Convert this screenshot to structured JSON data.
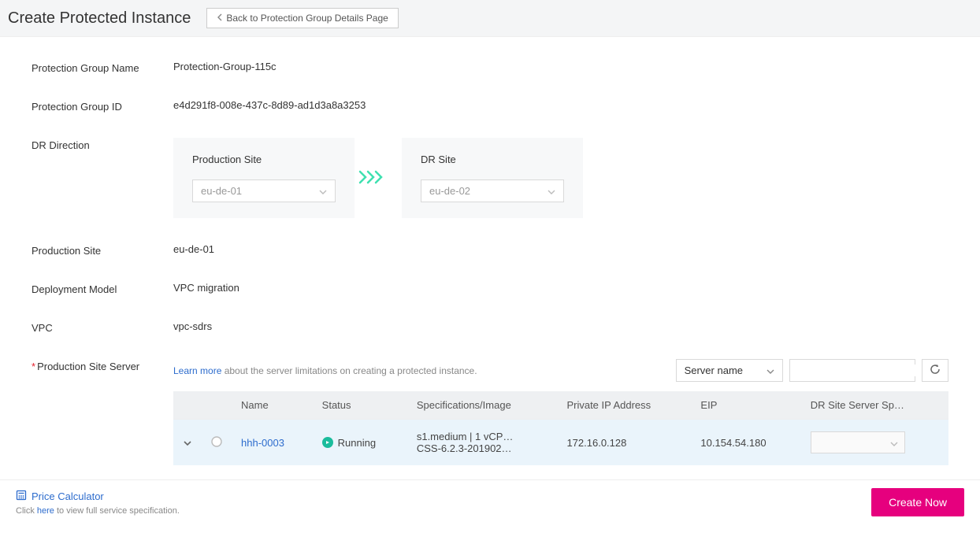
{
  "header": {
    "title": "Create Protected Instance",
    "back_label": "Back to Protection Group Details Page"
  },
  "labels": {
    "group_name": "Protection Group Name",
    "group_id": "Protection Group ID",
    "dr_direction": "DR Direction",
    "production_site": "Production Site",
    "deployment_model": "Deployment Model",
    "vpc": "VPC",
    "prod_site_server": "Production Site Server"
  },
  "values": {
    "group_name": "Protection-Group-115c",
    "group_id": "e4d291f8-008e-437c-8d89-ad1d3a8a3253",
    "production_site": "eu-de-01",
    "deployment_model": "VPC migration",
    "vpc": "vpc-sdrs"
  },
  "direction": {
    "prod_card_title": "Production Site",
    "prod_value": "eu-de-01",
    "dr_card_title": "DR Site",
    "dr_value": "eu-de-02"
  },
  "server_section": {
    "learn_more": "Learn more",
    "learn_suffix": " about the server limitations on creating a protected instance.",
    "filter_label": "Server name",
    "search_placeholder": ""
  },
  "table": {
    "headers": {
      "name": "Name",
      "status": "Status",
      "spec": "Specifications/Image",
      "ip": "Private IP Address",
      "eip": "EIP",
      "dr_spec": "DR Site Server Sp…"
    },
    "rows": [
      {
        "name": "hhh-0003",
        "status": "Running",
        "spec_line1": "s1.medium | 1 vCP…",
        "spec_line2": "CSS-6.2.3-201902…",
        "ip": "172.16.0.128",
        "eip": "10.154.54.180"
      }
    ]
  },
  "footer": {
    "price_calc": "Price Calculator",
    "note_prefix": "Click ",
    "note_link": "here",
    "note_suffix": " to view full service specification.",
    "create_label": "Create Now"
  }
}
